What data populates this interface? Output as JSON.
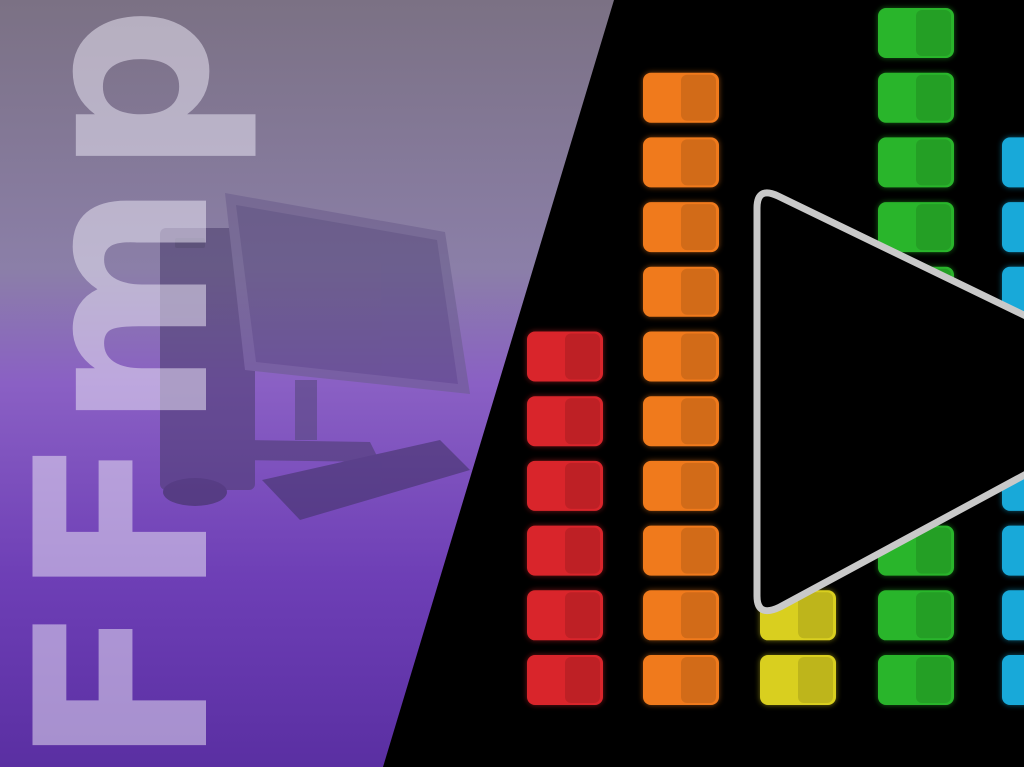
{
  "logo": {
    "text": "FFmpeg"
  },
  "colors": {
    "panel_top": "#7b7184",
    "panel_mid": "#8a60c4",
    "panel_bottom": "#5a2fa2",
    "background": "#000000",
    "play_outline": "#c9c9c9",
    "meter_red": "#d9252b",
    "meter_orange": "#f07a1c",
    "meter_yellow": "#d9cf1f",
    "meter_green": "#29b52b",
    "meter_cyan": "#18a9d9"
  },
  "icons": {
    "play": "play-icon",
    "computer": "desktop-computer-icon"
  },
  "equalizer": {
    "red_segments_lit": 6,
    "orange_segments_lit": 10,
    "yellow_segments_visible": 2,
    "green_segments_lit": 11,
    "cyan_segments_visible": 9
  }
}
